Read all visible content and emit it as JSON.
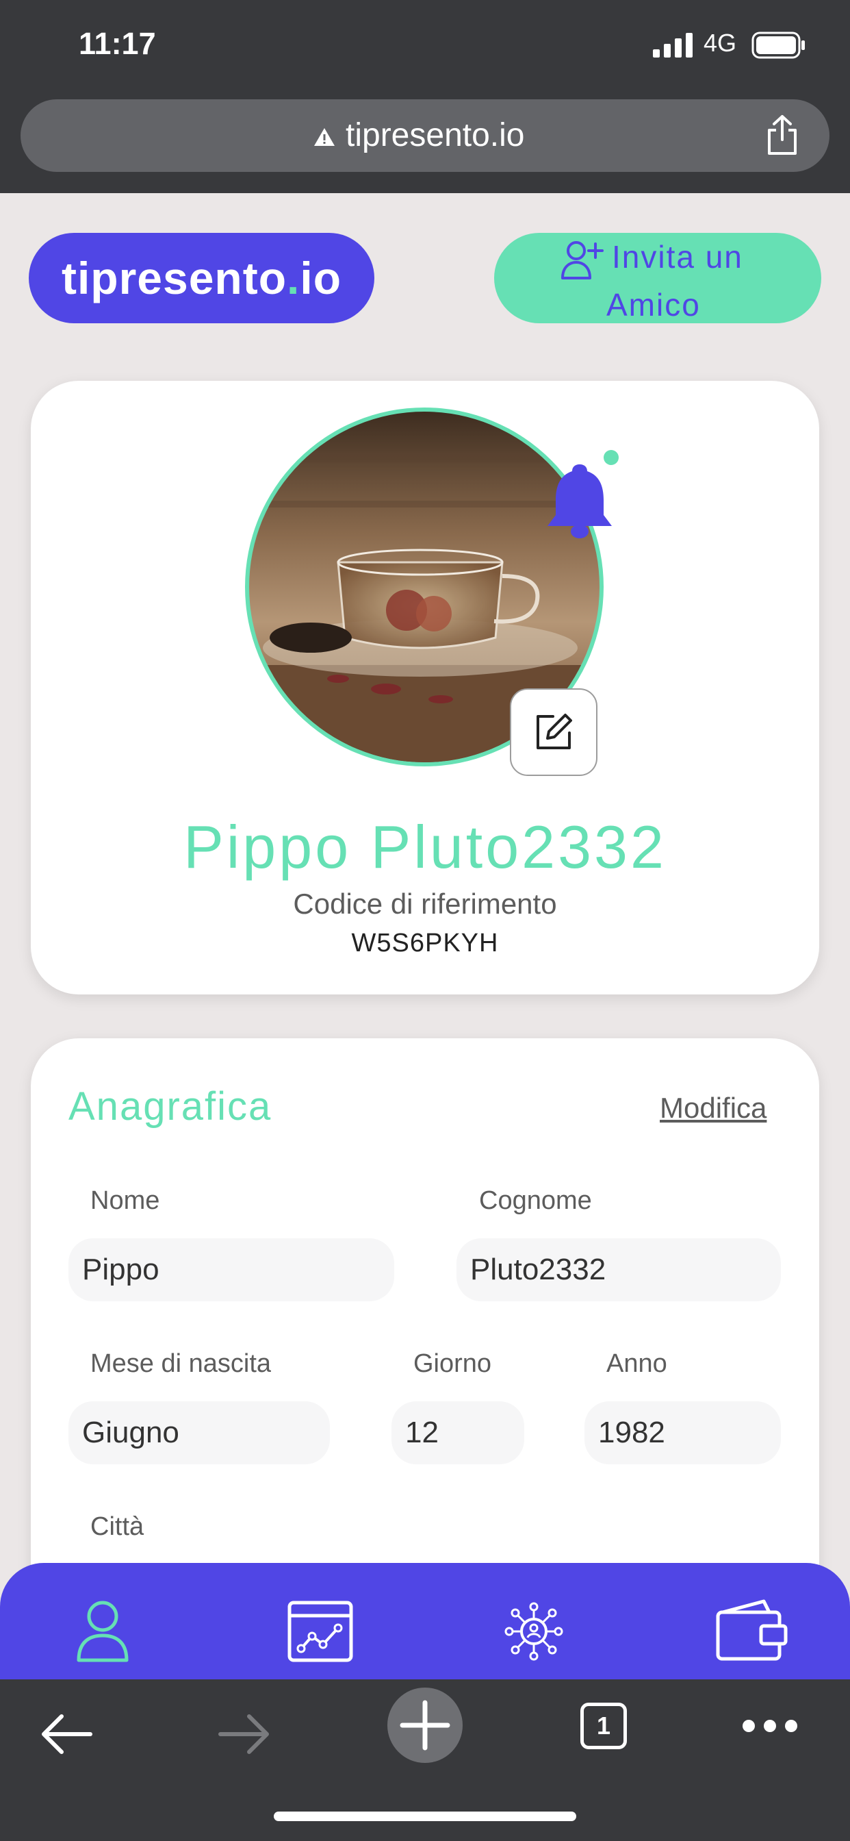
{
  "status": {
    "time": "11:17",
    "network": "4G"
  },
  "browser": {
    "url": "tipresento.io",
    "tab_count": "1"
  },
  "header": {
    "logo_main": "tipresento",
    "logo_dot": ".",
    "logo_tld": "io",
    "invite_line1": "Invita un",
    "invite_line2": "Amico"
  },
  "profile": {
    "name": "Pippo Pluto2332",
    "ref_label": "Codice di riferimento",
    "ref_code": "W5S6PKYH"
  },
  "anagrafica": {
    "title": "Anagrafica",
    "edit_link": "Modifica",
    "fields": {
      "nome": {
        "label": "Nome",
        "value": "Pippo"
      },
      "cognome": {
        "label": "Cognome",
        "value": "Pluto2332"
      },
      "mese": {
        "label": "Mese di nascita",
        "value": "Giugno"
      },
      "giorno": {
        "label": "Giorno",
        "value": "12"
      },
      "anno": {
        "label": "Anno",
        "value": "1982"
      },
      "citta": {
        "label": "Città"
      }
    }
  },
  "nav": {
    "items": [
      {
        "icon": "user-icon",
        "active": true
      },
      {
        "icon": "chart-icon",
        "active": false
      },
      {
        "icon": "network-icon",
        "active": false
      },
      {
        "icon": "wallet-icon",
        "active": false
      }
    ]
  },
  "colors": {
    "brand": "#5046e5",
    "accent": "#66e0b4",
    "browser_chrome": "#38393c",
    "page_bg": "#ebe7e7"
  }
}
